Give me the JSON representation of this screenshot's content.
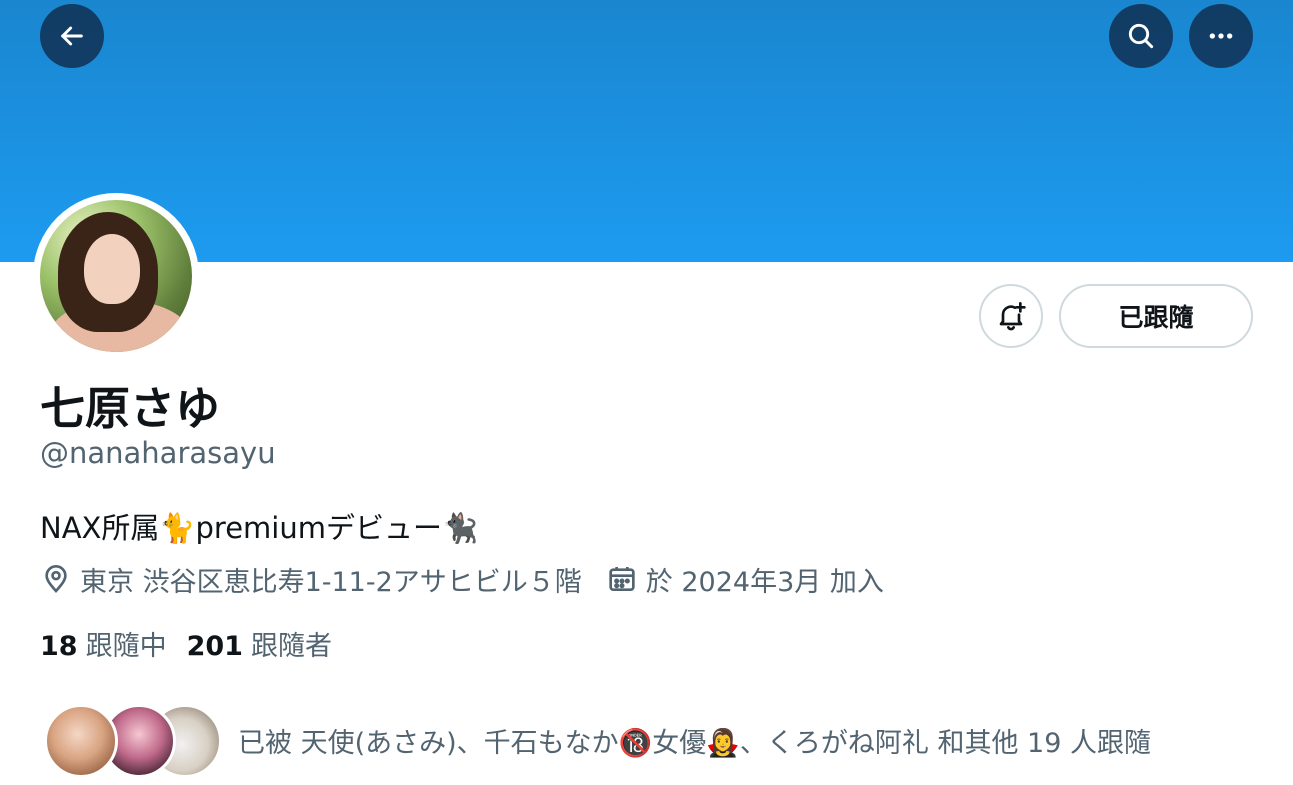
{
  "banner": {
    "color": "#1d9bf0"
  },
  "header_buttons": {
    "back_icon": "arrow-left-icon",
    "search_icon": "search-icon",
    "more_icon": "more-horizontal-icon"
  },
  "profile": {
    "name": "七原さゆ",
    "handle": "@nanaharasayu",
    "bio": "NAX所属🐈premiumデビュー🐈‍⬛",
    "location": "東京 渋谷区恵比寿1-11-2アサヒビル５階",
    "joined": "於 2024年3月 加入"
  },
  "actions": {
    "notify_icon": "bell-plus-icon",
    "follow_label": "已跟隨"
  },
  "stats": {
    "following_count": "18",
    "following_label": "跟隨中",
    "followers_count": "201",
    "followers_label": "跟隨者"
  },
  "followed_by": {
    "text": "已被 天使(あさみ)、千石もなか🔞女優🧛‍♀️、くろがね阿礼 和其他 19 人跟隨"
  },
  "colors": {
    "text_primary": "#0f1419",
    "text_secondary": "#536471",
    "border": "#cfd9de"
  }
}
